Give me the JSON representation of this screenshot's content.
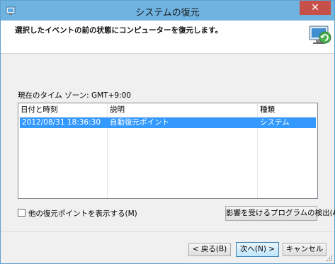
{
  "window": {
    "title": "システムの復元",
    "close_label": "✕"
  },
  "header": {
    "title": "選択したイベントの前の状態にコンピューターを復元します。"
  },
  "timezone": {
    "label": "現在のタイム ゾーン: GMT+9:00"
  },
  "list": {
    "columns": [
      "日付と時刻",
      "説明",
      "種類"
    ],
    "rows": [
      {
        "datetime": "2012/08/31 18:36:30",
        "description": "自動復元ポイント",
        "type": "システム",
        "selected": true
      }
    ]
  },
  "options": {
    "show_more_label": "他の復元ポイントを表示する(M)",
    "show_more_checked": false
  },
  "buttons": {
    "detect": "影響を受けるプログラムの検出(A)",
    "back": "< 戻る(B)",
    "next": "次へ(N) >",
    "cancel": "キャンセル"
  },
  "colors": {
    "titlebar": "#6fb3e1",
    "selection": "#3399ff",
    "close": "#c7504b"
  }
}
